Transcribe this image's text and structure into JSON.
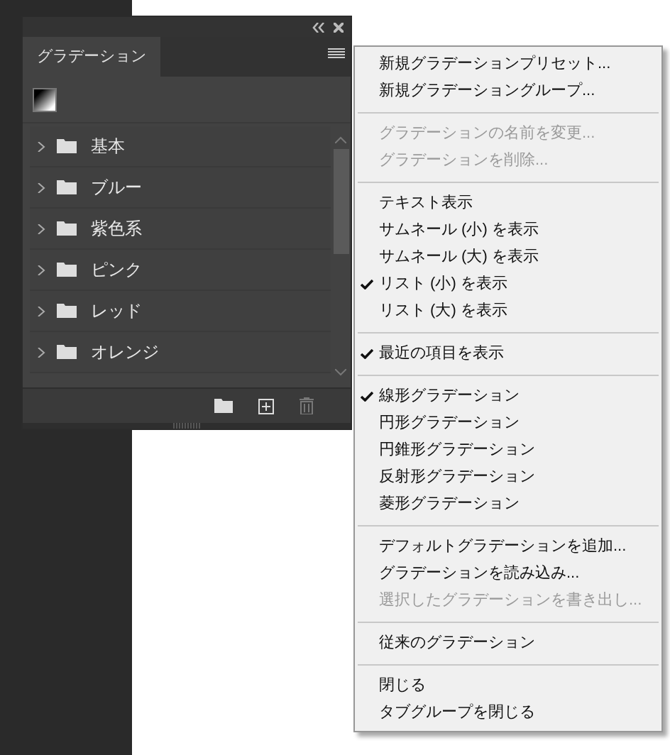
{
  "panel": {
    "tabs": [
      {
        "label": "グラデーション",
        "selected": true
      }
    ],
    "groups": [
      {
        "label": "基本",
        "expanded": false
      },
      {
        "label": "ブルー",
        "expanded": false
      },
      {
        "label": "紫色系",
        "expanded": false
      },
      {
        "label": "ピンク",
        "expanded": false
      },
      {
        "label": "レッド",
        "expanded": false
      },
      {
        "label": "オレンジ",
        "expanded": false
      }
    ]
  },
  "menu": {
    "sections": [
      {
        "items": [
          {
            "label": "新規グラデーションプリセット...",
            "checked": false,
            "disabled": false
          },
          {
            "label": "新規グラデーショングループ...",
            "checked": false,
            "disabled": false
          }
        ]
      },
      {
        "items": [
          {
            "label": "グラデーションの名前を変更...",
            "checked": false,
            "disabled": true
          },
          {
            "label": "グラデーションを削除...",
            "checked": false,
            "disabled": true
          }
        ]
      },
      {
        "items": [
          {
            "label": "テキスト表示",
            "checked": false,
            "disabled": false
          },
          {
            "label": "サムネール (小) を表示",
            "checked": false,
            "disabled": false
          },
          {
            "label": "サムネール (大) を表示",
            "checked": false,
            "disabled": false
          },
          {
            "label": "リスト (小) を表示",
            "checked": true,
            "disabled": false
          },
          {
            "label": "リスト (大) を表示",
            "checked": false,
            "disabled": false
          }
        ]
      },
      {
        "items": [
          {
            "label": "最近の項目を表示",
            "checked": true,
            "disabled": false
          }
        ]
      },
      {
        "items": [
          {
            "label": "線形グラデーション",
            "checked": true,
            "disabled": false
          },
          {
            "label": "円形グラデーション",
            "checked": false,
            "disabled": false
          },
          {
            "label": "円錐形グラデーション",
            "checked": false,
            "disabled": false
          },
          {
            "label": "反射形グラデーション",
            "checked": false,
            "disabled": false
          },
          {
            "label": "菱形グラデーション",
            "checked": false,
            "disabled": false
          }
        ]
      },
      {
        "items": [
          {
            "label": "デフォルトグラデーションを追加...",
            "checked": false,
            "disabled": false
          },
          {
            "label": "グラデーションを読み込み...",
            "checked": false,
            "disabled": false
          },
          {
            "label": "選択したグラデーションを書き出し...",
            "checked": false,
            "disabled": true
          }
        ]
      },
      {
        "items": [
          {
            "label": "従来のグラデーション",
            "checked": false,
            "disabled": false
          }
        ]
      },
      {
        "items": [
          {
            "label": "閉じる",
            "checked": false,
            "disabled": false
          },
          {
            "label": "タブグループを閉じる",
            "checked": false,
            "disabled": false
          }
        ]
      }
    ]
  }
}
